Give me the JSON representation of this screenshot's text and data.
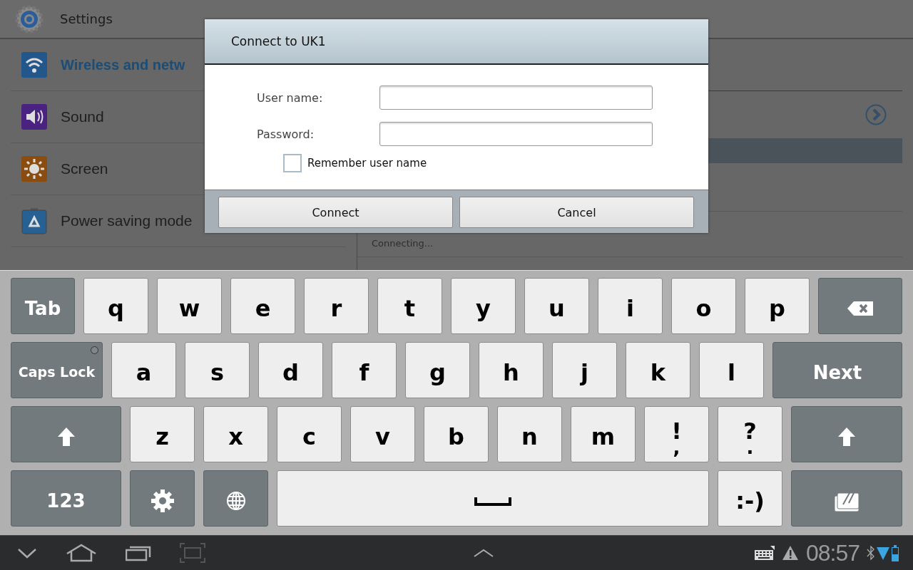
{
  "app_bar": {
    "title": "Settings"
  },
  "sidebar": {
    "items": [
      {
        "label": "Wireless and netw",
        "selected": true
      },
      {
        "label": "Sound",
        "selected": false
      },
      {
        "label": "Screen",
        "selected": false
      },
      {
        "label": "Power saving mode",
        "selected": false
      }
    ]
  },
  "detail": {
    "status": "Connecting..."
  },
  "dialog": {
    "title": "Connect to UK1",
    "fields": [
      {
        "label": "User name:"
      },
      {
        "label": "Password:"
      }
    ],
    "remember": {
      "label": "Remember user name",
      "checked": false
    },
    "buttons": [
      "Connect",
      "Cancel"
    ]
  },
  "keyboard": {
    "rows": [
      [
        {
          "kind": "function",
          "label": "Tab"
        },
        {
          "kind": "letter",
          "label": "q"
        },
        {
          "kind": "letter",
          "label": "w"
        },
        {
          "kind": "letter",
          "label": "e"
        },
        {
          "kind": "letter",
          "label": "r"
        },
        {
          "kind": "letter",
          "label": "t"
        },
        {
          "kind": "letter",
          "label": "y"
        },
        {
          "kind": "letter",
          "label": "u"
        },
        {
          "kind": "letter",
          "label": "i"
        },
        {
          "kind": "letter",
          "label": "o"
        },
        {
          "kind": "letter",
          "label": "p"
        },
        {
          "kind": "backspace"
        }
      ],
      [
        {
          "kind": "function",
          "label": "Caps Lock",
          "on": false
        },
        {
          "kind": "letter",
          "label": "a"
        },
        {
          "kind": "letter",
          "label": "s"
        },
        {
          "kind": "letter",
          "label": "d"
        },
        {
          "kind": "letter",
          "label": "f"
        },
        {
          "kind": "letter",
          "label": "g"
        },
        {
          "kind": "letter",
          "label": "h"
        },
        {
          "kind": "letter",
          "label": "j"
        },
        {
          "kind": "letter",
          "label": "k"
        },
        {
          "kind": "letter",
          "label": "l"
        },
        {
          "kind": "function",
          "label": "Next"
        }
      ],
      [
        {
          "kind": "shift"
        },
        {
          "kind": "letter",
          "label": "z"
        },
        {
          "kind": "letter",
          "label": "x"
        },
        {
          "kind": "letter",
          "label": "c"
        },
        {
          "kind": "letter",
          "label": "v"
        },
        {
          "kind": "letter",
          "label": "b"
        },
        {
          "kind": "letter",
          "label": "n"
        },
        {
          "kind": "letter",
          "label": "m"
        },
        {
          "kind": "letter",
          "label": "!",
          "sub": ","
        },
        {
          "kind": "letter",
          "label": "?",
          "sub": "."
        },
        {
          "kind": "shift"
        }
      ],
      [
        {
          "kind": "function",
          "label": "123"
        },
        {
          "kind": "settings"
        },
        {
          "kind": "language"
        },
        {
          "kind": "space"
        },
        {
          "kind": "letter",
          "label": ":-)"
        },
        {
          "kind": "clipboard"
        }
      ]
    ]
  },
  "status_bar": {
    "time": "08:57"
  }
}
